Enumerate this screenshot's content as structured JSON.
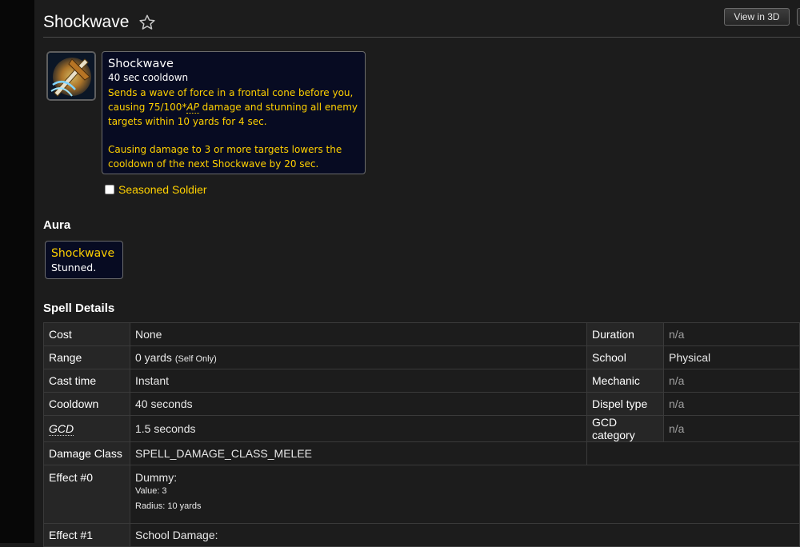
{
  "header": {
    "title": "Shockwave",
    "view_3d_label": "View in 3D"
  },
  "tooltip": {
    "name": "Shockwave",
    "cooldown": "40 sec cooldown",
    "desc_pre": "Sends a wave of force in a frontal cone before you, causing 75/100*",
    "desc_ap": "AP",
    "desc_post": " damage and stunning all enemy targets within 10 yards for 4 sec.",
    "desc2": "Causing damage to 3 or more targets lowers the cooldown of the next Shockwave by 20 sec."
  },
  "option": {
    "label": "Seasoned Soldier",
    "checked": false
  },
  "aura_section": {
    "heading": "Aura",
    "name": "Shockwave",
    "desc": "Stunned."
  },
  "details": {
    "heading": "Spell Details",
    "rows": [
      {
        "label": "Cost",
        "value": "None",
        "right_label": "Duration",
        "right_value": "n/a"
      },
      {
        "label": "Range",
        "value": "0 yards",
        "value_note": "(Self Only)",
        "right_label": "School",
        "right_value": "Physical"
      },
      {
        "label": "Cast time",
        "value": "Instant",
        "right_label": "Mechanic",
        "right_value": "n/a"
      },
      {
        "label": "Cooldown",
        "value": "40 seconds",
        "right_label": "Dispel type",
        "right_value": "n/a"
      },
      {
        "label": "GCD",
        "value": "1.5 seconds",
        "right_label": "GCD category",
        "right_value": "n/a"
      },
      {
        "label": "Damage Class",
        "value": "SPELL_DAMAGE_CLASS_MELEE"
      }
    ],
    "effects": [
      {
        "label": "Effect #0",
        "value": "Dummy:",
        "lines": [
          "Value: 3",
          "Radius: 10 yards"
        ]
      },
      {
        "label": "Effect #1",
        "value": "School Damage:"
      }
    ]
  },
  "colors": {
    "accent_gold": "#ffd100",
    "tooltip_bg": "#070b22",
    "page_bg": "#1c1c1c"
  }
}
